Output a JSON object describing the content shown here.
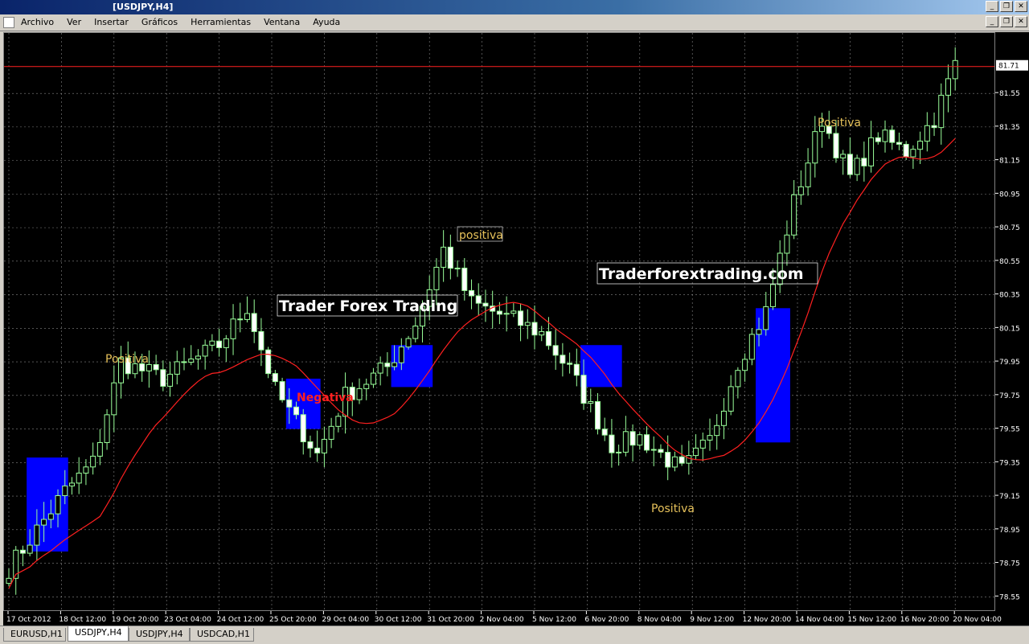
{
  "window": {
    "title": "[USDJPY,H4]"
  },
  "menu": [
    "Archivo",
    "Ver",
    "Insertar",
    "Gráficos",
    "Herramientas",
    "Ventana",
    "Ayuda"
  ],
  "colors": {
    "bull": "#9aff9a",
    "bear": "#ffffff",
    "ma": "#ff2020",
    "box": "#0000ff",
    "label": "#e6c15a",
    "negativa": "#ff2020",
    "grid": "#c0c0c0"
  },
  "chart_data": {
    "type": "candlestick",
    "symbol": "USDJPY",
    "timeframe": "H4",
    "ylim": [
      78.47,
      81.91
    ],
    "price_ticks": [
      "81.55",
      "81.35",
      "81.15",
      "80.95",
      "80.75",
      "80.55",
      "80.35",
      "80.15",
      "79.95",
      "79.75",
      "79.55",
      "79.35",
      "79.15",
      "78.95",
      "78.75",
      "78.55"
    ],
    "current_price": "81.71",
    "time_labels": [
      "17 Oct 2012",
      "18 Oct 12:00",
      "19 Oct 20:00",
      "23 Oct 04:00",
      "24 Oct 12:00",
      "25 Oct 20:00",
      "29 Oct 04:00",
      "30 Oct 12:00",
      "31 Oct 20:00",
      "2 Nov 04:00",
      "5 Nov 12:00",
      "6 Nov 20:00",
      "8 Nov 04:00",
      "9 Nov 12:00",
      "12 Nov 20:00",
      "14 Nov 04:00",
      "15 Nov 12:00",
      "16 Nov 20:00",
      "20 Nov 04:00"
    ],
    "waypoints": [
      [
        0,
        78.72
      ],
      [
        8,
        79.18
      ],
      [
        12,
        79.35
      ],
      [
        16,
        79.95
      ],
      [
        22,
        79.85
      ],
      [
        30,
        80.05
      ],
      [
        34,
        80.28
      ],
      [
        38,
        79.78
      ],
      [
        44,
        79.4
      ],
      [
        48,
        79.75
      ],
      [
        54,
        79.92
      ],
      [
        58,
        80.18
      ],
      [
        62,
        80.62
      ],
      [
        66,
        80.3
      ],
      [
        72,
        80.2
      ],
      [
        76,
        80.12
      ],
      [
        80,
        79.9
      ],
      [
        86,
        79.45
      ],
      [
        90,
        79.5
      ],
      [
        96,
        79.3
      ],
      [
        100,
        79.48
      ],
      [
        104,
        79.95
      ],
      [
        108,
        80.25
      ],
      [
        112,
        80.9
      ],
      [
        116,
        81.4
      ],
      [
        120,
        81.05
      ],
      [
        124,
        81.3
      ],
      [
        128,
        81.2
      ],
      [
        132,
        81.4
      ],
      [
        135,
        81.72
      ]
    ],
    "candle_count": 136,
    "annotations": [
      "Positiva",
      "Negativa",
      "positiva",
      "Positiva",
      "Positiva"
    ],
    "watermarks": [
      "Trader Forex Trading",
      "Traderforextrading.com"
    ],
    "boxes": [
      {
        "from": 3,
        "to": 8,
        "low": 78.82,
        "high": 79.38
      },
      {
        "from": 40,
        "to": 44,
        "low": 79.55,
        "high": 79.85
      },
      {
        "from": 55,
        "to": 60,
        "low": 79.8,
        "high": 80.05
      },
      {
        "from": 82,
        "to": 87,
        "low": 79.8,
        "high": 80.05
      },
      {
        "from": 107,
        "to": 111,
        "low": 79.47,
        "high": 80.27
      }
    ]
  },
  "tabs": [
    {
      "label": "EURUSD,H1",
      "active": false
    },
    {
      "label": "USDJPY,H4",
      "active": true
    },
    {
      "label": "USDJPY,H4",
      "active": false
    },
    {
      "label": "USDCAD,H1",
      "active": false
    }
  ]
}
